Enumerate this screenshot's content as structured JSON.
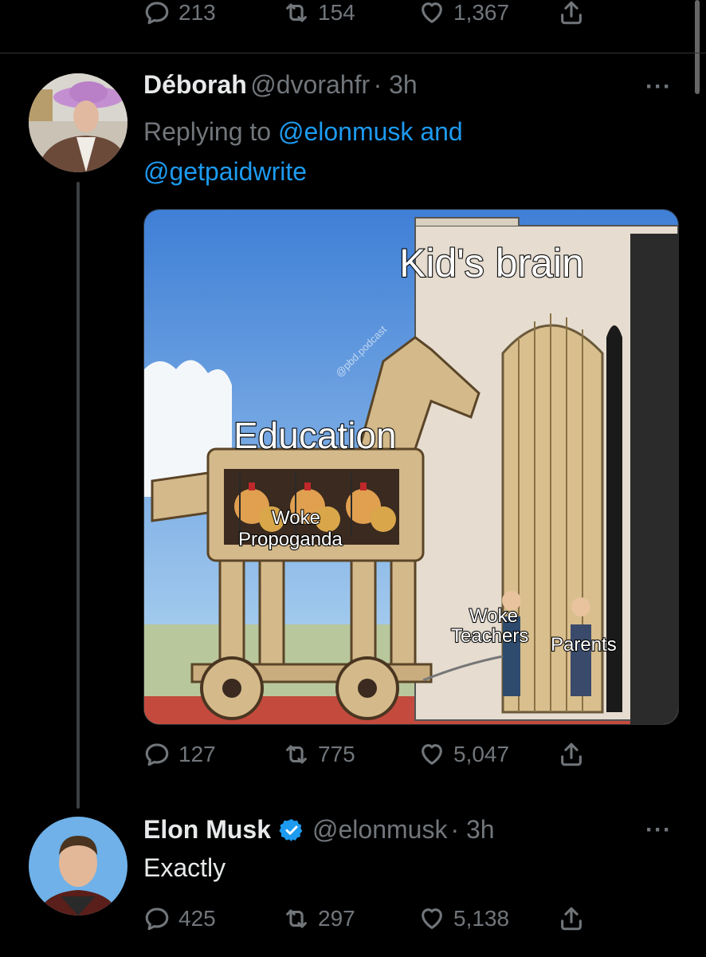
{
  "top_actions": {
    "replies": "213",
    "retweets": "154",
    "likes": "1,367"
  },
  "reply_tweet": {
    "name": "Déborah",
    "handle": "@dvorahfr",
    "time": "· 3h",
    "replying_prefix": "Replying to",
    "replying_user1": "@elonmusk",
    "replying_and": "and",
    "replying_user2": "@getpaidwrite",
    "image": {
      "label_kids_brain": "Kid's brain",
      "label_education": "Education",
      "label_woke_propoganda_1": "Woke",
      "label_woke_propoganda_2": "Propoganda",
      "label_woke_teachers_1": "Woke",
      "label_woke_teachers_2": "Teachers",
      "label_parents": "Parents",
      "watermark": "@pbd.podcast"
    },
    "actions": {
      "replies": "127",
      "retweets": "775",
      "likes": "5,047"
    }
  },
  "main_tweet": {
    "name": "Elon Musk",
    "handle": "@elonmusk",
    "time": "· 3h",
    "text": "Exactly",
    "verified": true,
    "actions": {
      "replies": "425",
      "retweets": "297",
      "likes": "5,138"
    }
  },
  "icons": {
    "reply": "reply-icon",
    "retweet": "retweet-icon",
    "like": "heart-icon",
    "share": "share-icon",
    "more": "more-icon",
    "verified": "verified-badge-icon"
  },
  "colors": {
    "link": "#1d9bf0",
    "verified": "#1d9bf0",
    "muted": "#71767b"
  }
}
